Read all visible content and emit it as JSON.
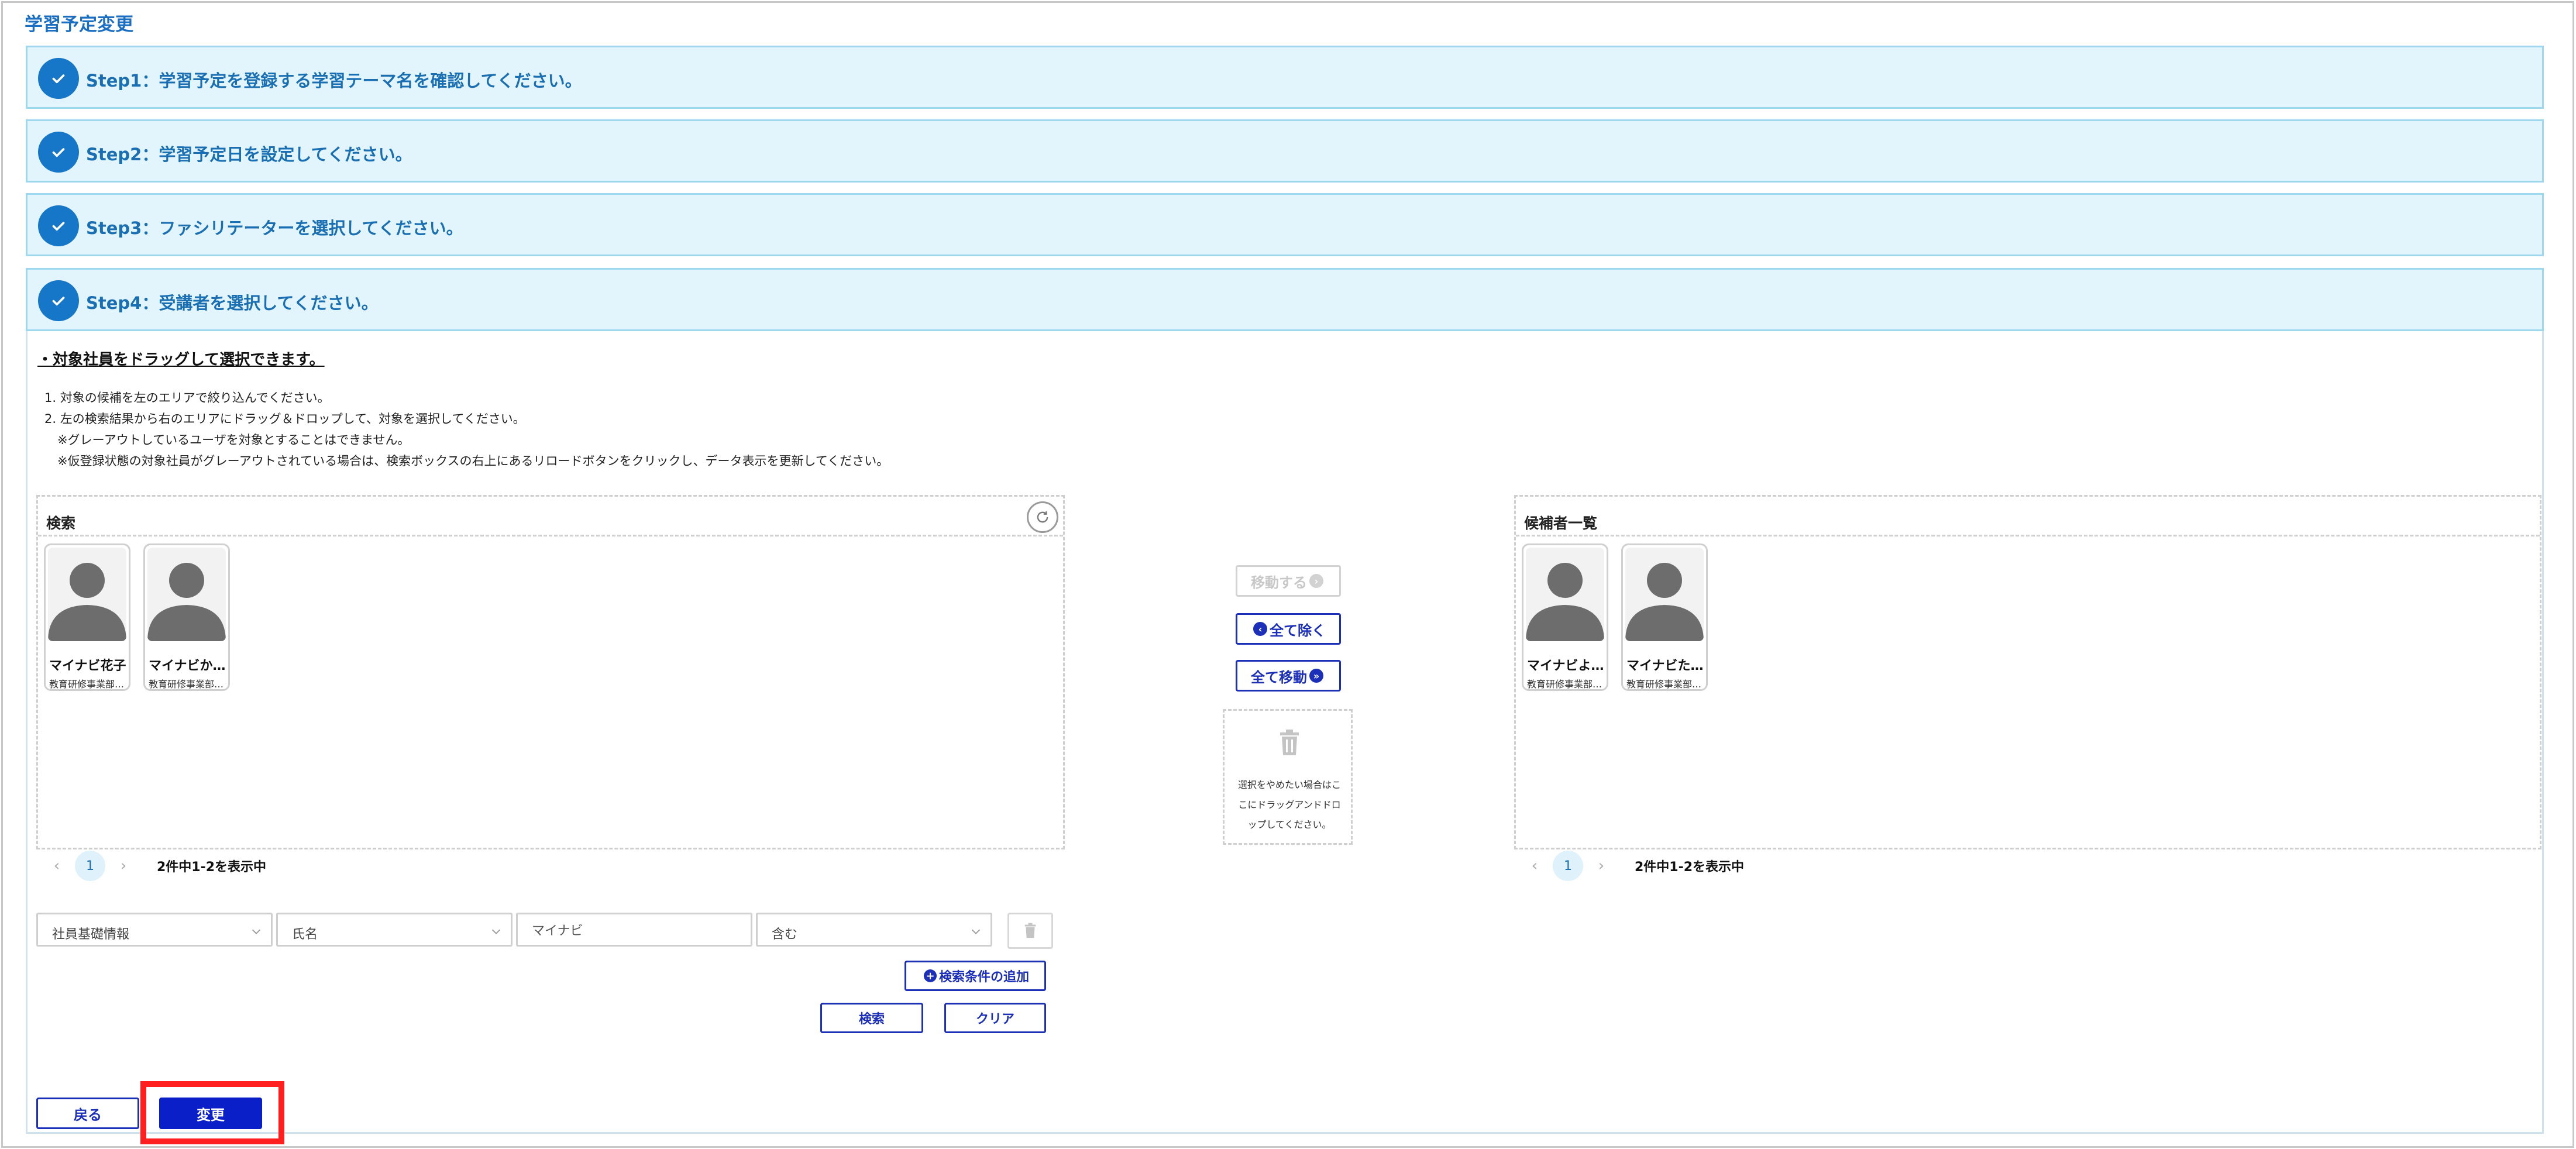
{
  "page": {
    "title": "学習予定変更"
  },
  "steps": [
    {
      "label": "Step1：学習予定を登録する学習テーマ名を確認してください。"
    },
    {
      "label": "Step2：学習予定日を設定してください。"
    },
    {
      "label": "Step3：ファシリテーターを選択してください。"
    },
    {
      "label": "Step4：受講者を選択してください。"
    }
  ],
  "instructions": {
    "title": "・対象社員をドラッグして選択できます。",
    "lines": [
      "1. 対象の候補を左のエリアで絞り込んでください。",
      "2. 左の検索結果から右のエリアにドラッグ＆ドロップして、対象を選択してください。",
      "※グレーアウトしているユーザを対象とすることはできません。",
      "※仮登録状態の対象社員がグレーアウトされている場合は、検索ボックスの右上にあるリロードボタンをクリックし、データ表示を更新してください。"
    ]
  },
  "search_panel": {
    "title": "検索",
    "cards": [
      {
        "name": "マイナビ花子",
        "dept": "教育研修事業部…"
      },
      {
        "name": "マイナビか…",
        "dept": "教育研修事業部…"
      }
    ],
    "pagination": {
      "prev": "‹",
      "page": "1",
      "next": "›",
      "count": "2件中1-2を表示中"
    }
  },
  "candidate_panel": {
    "title": "候補者一覧",
    "cards": [
      {
        "name": "マイナビよ…",
        "dept": "教育研修事業部…"
      },
      {
        "name": "マイナビた…",
        "dept": "教育研修事業部…"
      }
    ],
    "pagination": {
      "prev": "‹",
      "page": "1",
      "next": "›",
      "count": "2件中1-2を表示中"
    }
  },
  "transfer": {
    "move_label": "移動する",
    "remove_all_label": "全て除く",
    "move_all_label": "全て移動",
    "trash_text": "選択をやめたい場合はここにドラッグアンドドロップしてください。"
  },
  "search_form": {
    "field1": "社員基礎情報",
    "field2": "氏名",
    "input_value": "マイナビ",
    "field3": "含む",
    "add_condition_label": "検索条件の追加",
    "search_label": "検索",
    "clear_label": "クリア"
  },
  "footer": {
    "back_label": "戻る",
    "change_label": "変更"
  },
  "colors": {
    "accent": "#1677c8",
    "step_bg": "#e2f5fd",
    "button_blue": "#1b2fb8",
    "primary_solid": "#0b1fc9",
    "highlight": "#ff1f1f"
  }
}
